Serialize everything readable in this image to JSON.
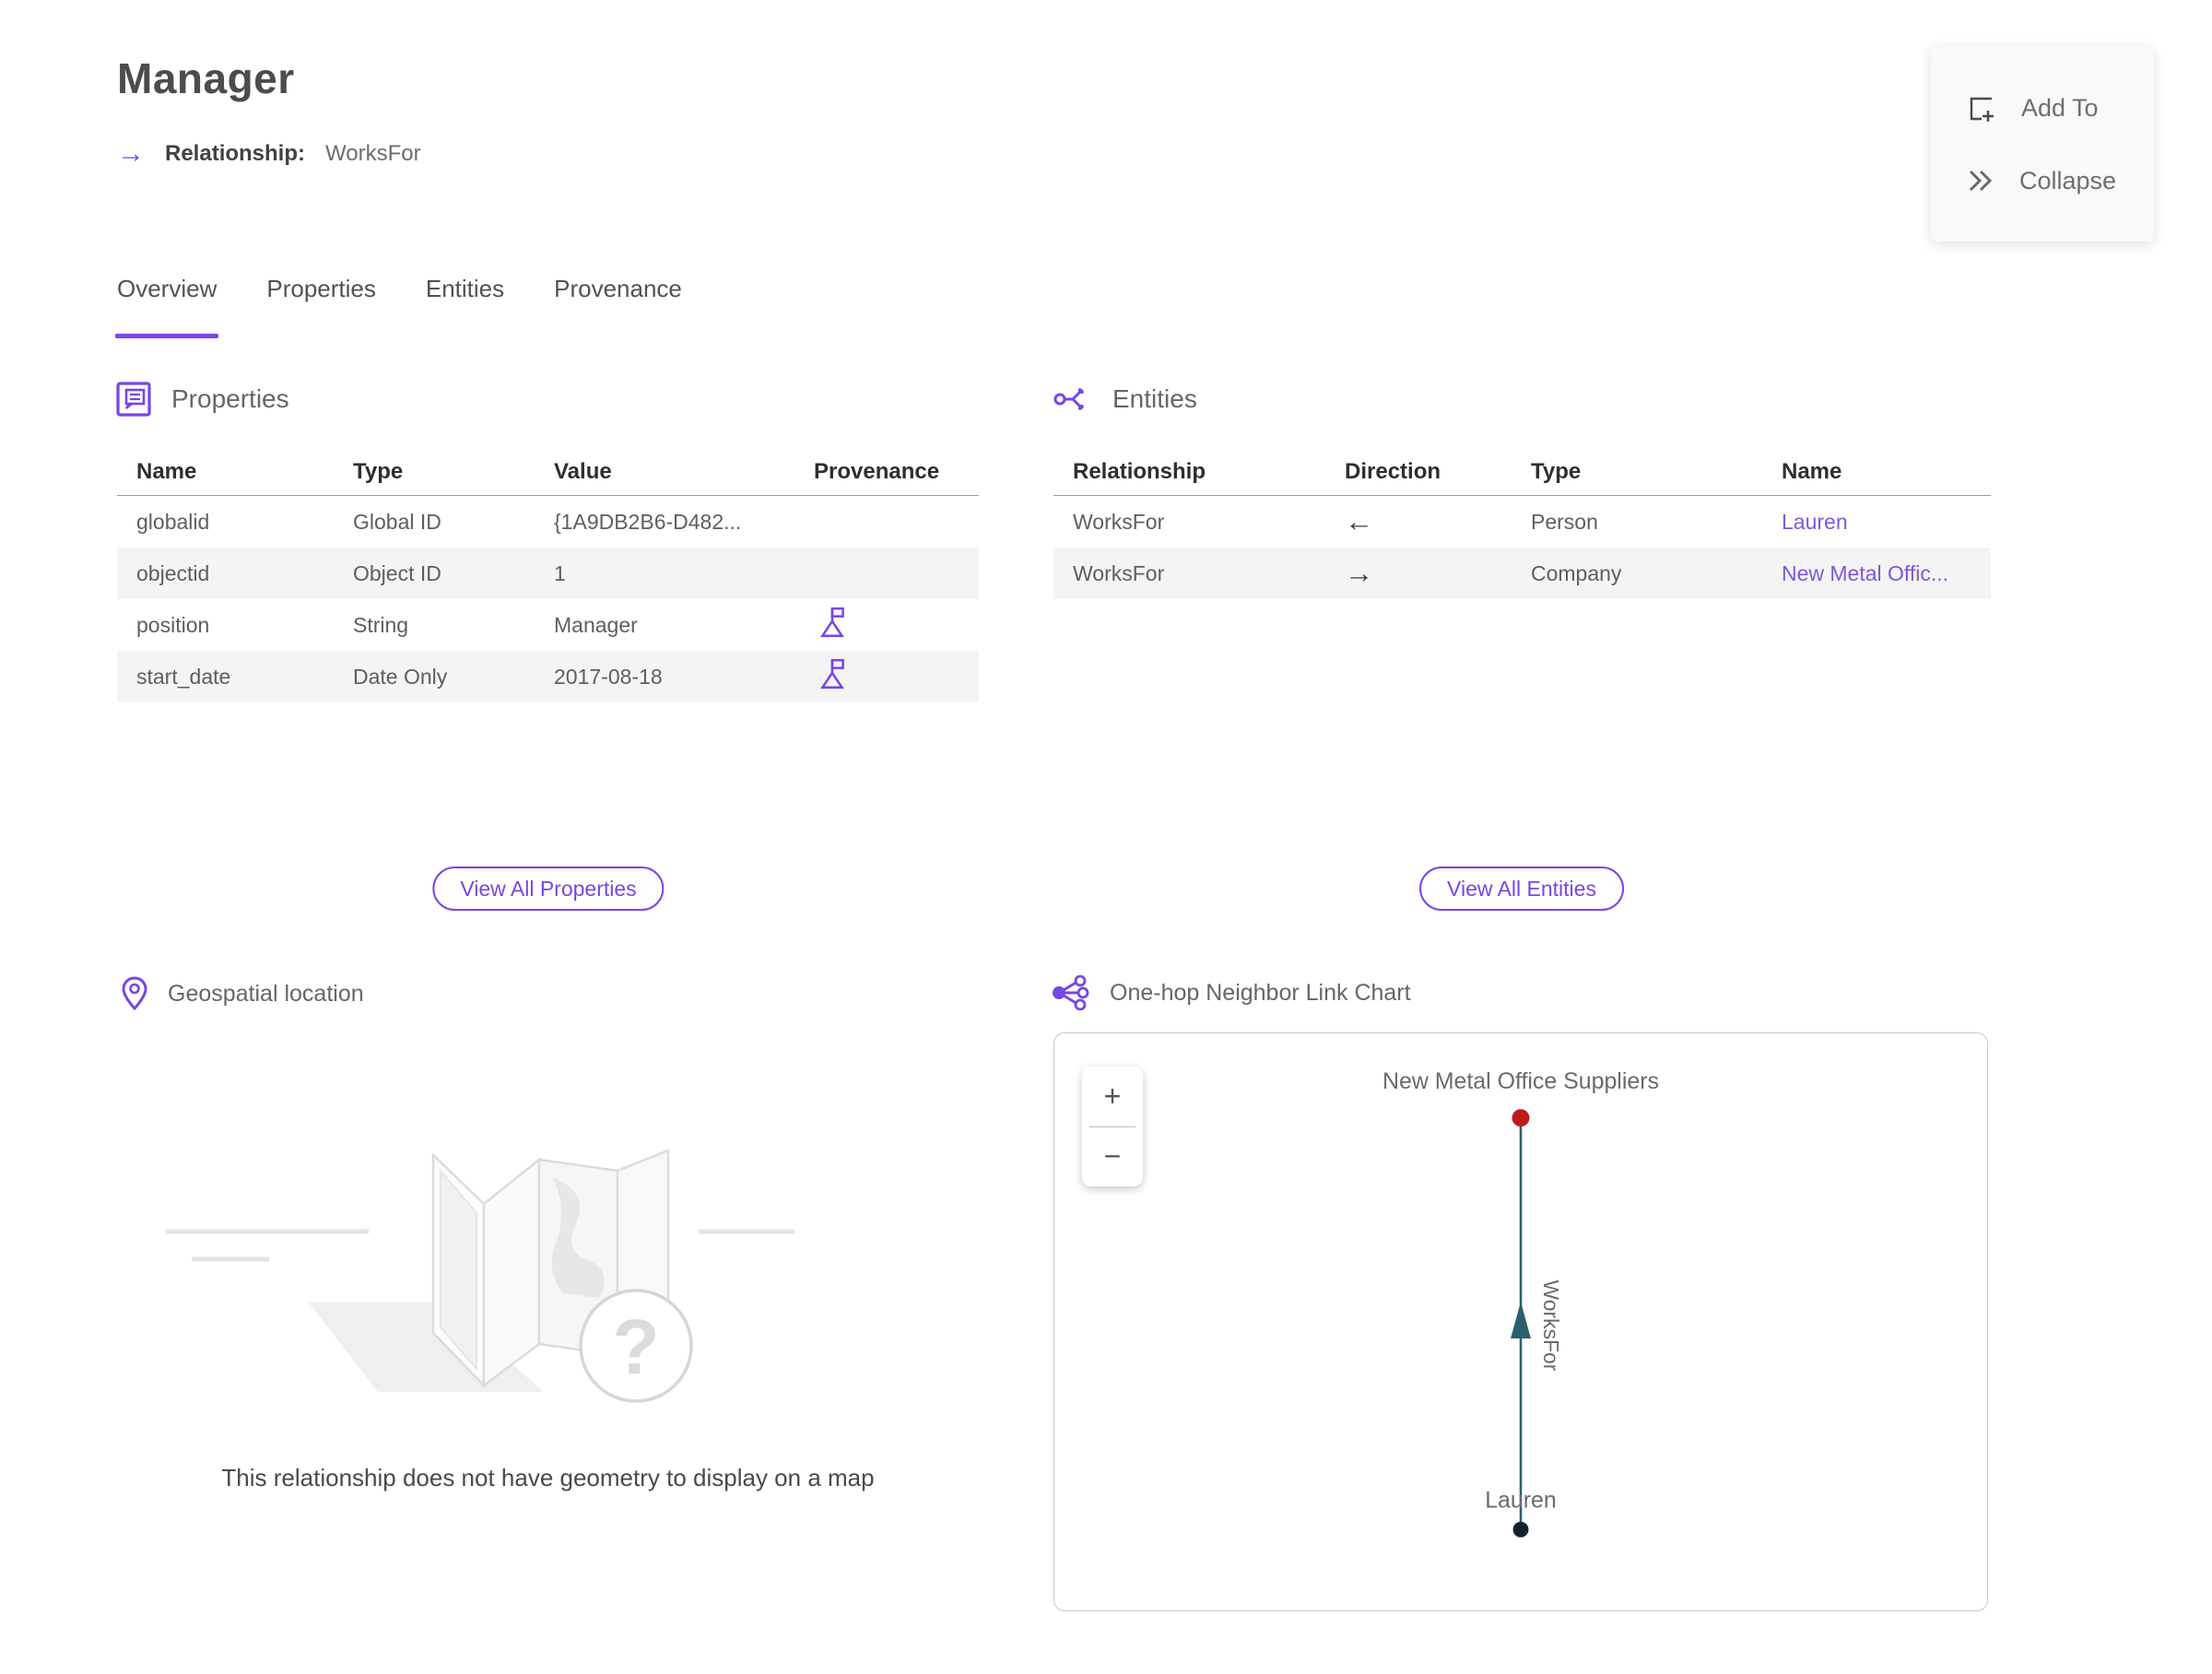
{
  "colors": {
    "accent": "#7845e6",
    "link": "#7d58e0",
    "edge_teal": "#2a5f6e",
    "node_top_red": "#c11a1f",
    "node_bottom_navy": "#13212e",
    "row_alt": "#f4f4f4"
  },
  "header": {
    "title": "Manager",
    "relationship_label": "Relationship:",
    "relationship_value": "WorksFor"
  },
  "actions": {
    "add_to": "Add To",
    "collapse": "Collapse"
  },
  "tabs": [
    {
      "label": "Overview",
      "active": true
    },
    {
      "label": "Properties",
      "active": false
    },
    {
      "label": "Entities",
      "active": false
    },
    {
      "label": "Provenance",
      "active": false
    }
  ],
  "properties_section": {
    "title": "Properties",
    "columns": [
      "Name",
      "Type",
      "Value",
      "Provenance"
    ],
    "rows": [
      {
        "name": "globalid",
        "type": "Global ID",
        "value": "{1A9DB2B6-D482...",
        "provenance": false
      },
      {
        "name": "objectid",
        "type": "Object ID",
        "value": "1",
        "provenance": false
      },
      {
        "name": "position",
        "type": "String",
        "value": "Manager",
        "provenance": true
      },
      {
        "name": "start_date",
        "type": "Date Only",
        "value": "2017-08-18",
        "provenance": true
      }
    ],
    "view_all": "View All Properties"
  },
  "entities_section": {
    "title": "Entities",
    "columns": [
      "Relationship",
      "Direction",
      "Type",
      "Name"
    ],
    "rows": [
      {
        "relationship": "WorksFor",
        "direction": "←",
        "type": "Person",
        "name": "Lauren"
      },
      {
        "relationship": "WorksFor",
        "direction": "→",
        "type": "Company",
        "name": "New Metal Offic..."
      }
    ],
    "view_all": "View All Entities"
  },
  "geospatial_section": {
    "title": "Geospatial location",
    "question_mark": "?",
    "empty_message": "This relationship does not have geometry to display on a map"
  },
  "link_chart_section": {
    "title": "One-hop Neighbor Link Chart",
    "zoom_in": "+",
    "zoom_out": "−",
    "chart_data": {
      "type": "graph",
      "nodes": [
        {
          "label": "New Metal Office Suppliers",
          "entity_type": "Company",
          "color": "#c11a1f",
          "position": "top"
        },
        {
          "label": "Lauren",
          "entity_type": "Person",
          "color": "#13212e",
          "position": "bottom"
        }
      ],
      "edges": [
        {
          "from": "Lauren",
          "to": "New Metal Office Suppliers",
          "label": "WorksFor",
          "direction": "up"
        }
      ]
    }
  }
}
